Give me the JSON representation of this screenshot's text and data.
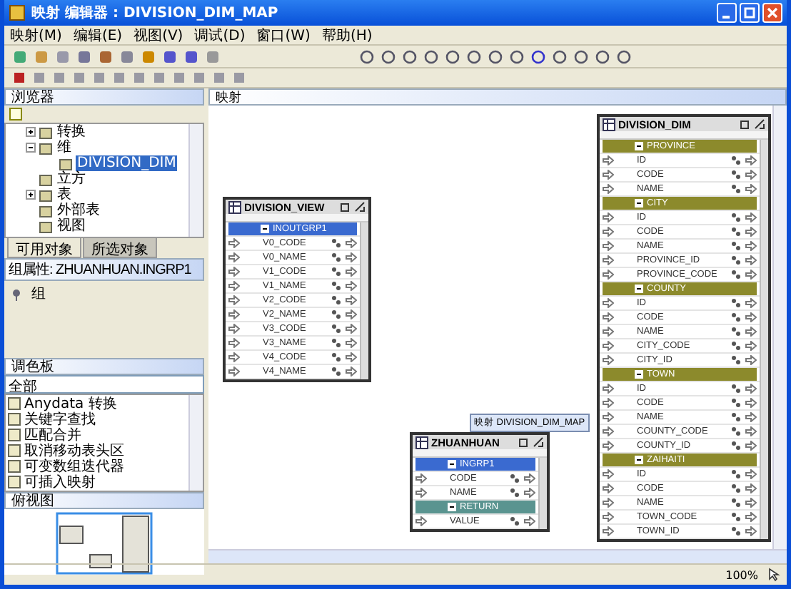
{
  "window": {
    "title": "映射 编辑器 : DIVISION_DIM_MAP"
  },
  "menu": [
    "映射(M)",
    "编辑(E)",
    "视图(V)",
    "调试(D)",
    "窗口(W)",
    "帮助(H)"
  ],
  "explorer": {
    "title": "浏览器",
    "tree": [
      {
        "label": "转换",
        "expanded": false,
        "selected": false
      },
      {
        "label": "维",
        "expanded": true,
        "selected": false,
        "children": [
          {
            "label": "DIVISION_DIM",
            "selected": true
          }
        ]
      },
      {
        "label": "立方",
        "selected": false
      },
      {
        "label": "表",
        "expanded": false,
        "selected": false
      },
      {
        "label": "外部表",
        "selected": false
      },
      {
        "label": "视图",
        "selected": false
      }
    ]
  },
  "tabs": [
    {
      "label": "可用对象",
      "selected": true
    },
    {
      "label": "所选对象",
      "selected": false
    }
  ],
  "properties": {
    "title": "组属性: ZHUANHUAN.INGRP1",
    "items": [
      "组"
    ]
  },
  "palette": {
    "title": "调色板",
    "filter": "全部",
    "items": [
      "Anydata 转换",
      "关键字查找",
      "匹配合并",
      "取消移动表头区",
      "可变数组迭代器",
      "可插入映射"
    ]
  },
  "overview": {
    "title": "俯视图"
  },
  "canvas": {
    "title": "映射",
    "tooltip": "映射 DIVISION_DIM_MAP",
    "tables": [
      {
        "title": "DIVISION_VIEW",
        "rows": [
          {
            "kind": "group",
            "label": "INOUTGRP1",
            "color": "#3a6ad0"
          },
          {
            "kind": "attr",
            "label": "V0_CODE"
          },
          {
            "kind": "attr",
            "label": "V0_NAME"
          },
          {
            "kind": "attr",
            "label": "V1_CODE"
          },
          {
            "kind": "attr",
            "label": "V1_NAME"
          },
          {
            "kind": "attr",
            "label": "V2_CODE"
          },
          {
            "kind": "attr",
            "label": "V2_NAME"
          },
          {
            "kind": "attr",
            "label": "V3_CODE"
          },
          {
            "kind": "attr",
            "label": "V3_NAME"
          },
          {
            "kind": "attr",
            "label": "V4_CODE"
          },
          {
            "kind": "attr",
            "label": "V4_NAME"
          }
        ]
      },
      {
        "title": "ZHUANHUAN",
        "rows": [
          {
            "kind": "group",
            "label": "INGRP1",
            "color": "#3a6ad0"
          },
          {
            "kind": "attr",
            "label": "CODE"
          },
          {
            "kind": "attr",
            "label": "NAME"
          },
          {
            "kind": "group",
            "label": "RETURN",
            "color": "#5a9490"
          },
          {
            "kind": "attr",
            "label": "VALUE"
          }
        ]
      },
      {
        "title": "DIVISION_DIM",
        "rows": [
          {
            "kind": "group",
            "label": "PROVINCE",
            "color": "#8c8a2c"
          },
          {
            "kind": "attr",
            "label": "ID"
          },
          {
            "kind": "attr",
            "label": "CODE"
          },
          {
            "kind": "attr",
            "label": "NAME"
          },
          {
            "kind": "group",
            "label": "CITY",
            "color": "#8c8a2c"
          },
          {
            "kind": "attr",
            "label": "ID"
          },
          {
            "kind": "attr",
            "label": "CODE"
          },
          {
            "kind": "attr",
            "label": "NAME"
          },
          {
            "kind": "attr",
            "label": "PROVINCE_ID"
          },
          {
            "kind": "attr",
            "label": "PROVINCE_CODE"
          },
          {
            "kind": "group",
            "label": "COUNTY",
            "color": "#8c8a2c"
          },
          {
            "kind": "attr",
            "label": "ID"
          },
          {
            "kind": "attr",
            "label": "CODE"
          },
          {
            "kind": "attr",
            "label": "NAME"
          },
          {
            "kind": "attr",
            "label": "CITY_CODE"
          },
          {
            "kind": "attr",
            "label": "CITY_ID"
          },
          {
            "kind": "group",
            "label": "TOWN",
            "color": "#8c8a2c"
          },
          {
            "kind": "attr",
            "label": "ID"
          },
          {
            "kind": "attr",
            "label": "CODE"
          },
          {
            "kind": "attr",
            "label": "NAME"
          },
          {
            "kind": "attr",
            "label": "COUNTY_CODE"
          },
          {
            "kind": "attr",
            "label": "COUNTY_ID"
          },
          {
            "kind": "group",
            "label": "ZAIHAITI",
            "color": "#8c8a2c"
          },
          {
            "kind": "attr",
            "label": "ID"
          },
          {
            "kind": "attr",
            "label": "CODE"
          },
          {
            "kind": "attr",
            "label": "NAME"
          },
          {
            "kind": "attr",
            "label": "TOWN_CODE"
          },
          {
            "kind": "attr",
            "label": "TOWN_ID"
          }
        ]
      }
    ]
  },
  "status_bar": {
    "zoom": "100%"
  }
}
